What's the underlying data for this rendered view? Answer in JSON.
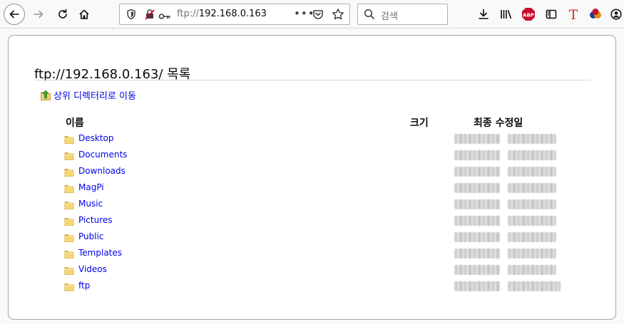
{
  "toolbar": {
    "url_protocol": "ftp://",
    "url_host": "192.168.0.163",
    "url_more": "•••",
    "search_placeholder": "검색"
  },
  "page": {
    "title": "ftp://192.168.0.163/ 목록",
    "parent_link": "상위 디렉터리로 이동",
    "columns": {
      "name": "이름",
      "size": "크기",
      "modified": "최종 수정일"
    }
  },
  "entries": [
    {
      "name": "Desktop"
    },
    {
      "name": "Documents"
    },
    {
      "name": "Downloads"
    },
    {
      "name": "MagPi"
    },
    {
      "name": "Music"
    },
    {
      "name": "Pictures"
    },
    {
      "name": "Public"
    },
    {
      "name": "Templates"
    },
    {
      "name": "Videos"
    },
    {
      "name": "ftp"
    }
  ],
  "colors": {
    "link": "#0000ee",
    "folder": "#f2c94c",
    "abp": "#c70d2c",
    "text_icon": "#d7301f"
  },
  "icons": [
    "back-arrow-icon",
    "forward-arrow-icon",
    "reload-icon",
    "home-icon",
    "shield-icon",
    "not-secure-icon",
    "key-icon",
    "pocket-icon",
    "star-icon",
    "search-icon",
    "download-icon",
    "library-icon",
    "adblock-plus-icon",
    "sidebar-icon",
    "text-t-icon",
    "color-balls-icon",
    "account-icon",
    "folder-icon",
    "up-folder-icon"
  ]
}
